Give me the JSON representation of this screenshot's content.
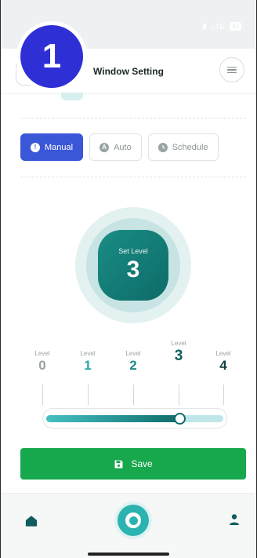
{
  "status_bar": {
    "network": "LTE",
    "battery": "82"
  },
  "step_badge": "1",
  "header": {
    "title": "Window Setting"
  },
  "modes": [
    {
      "label": "Manual",
      "active": true,
      "icon": "alert-circle-icon"
    },
    {
      "label": "Auto",
      "active": false,
      "icon": "auto-icon"
    },
    {
      "label": "Schedule",
      "active": false,
      "icon": "clock-icon"
    }
  ],
  "dial": {
    "label": "Set Level",
    "value": "3"
  },
  "levels": [
    {
      "name": "Level",
      "num": "0",
      "color": "#9aa2a2"
    },
    {
      "name": "Level",
      "num": "1",
      "color": "#27a6a6"
    },
    {
      "name": "Level",
      "num": "2",
      "color": "#1d8a89"
    },
    {
      "name": "Level",
      "num": "3",
      "color": "#0f5d5c"
    },
    {
      "name": "Level",
      "num": "4",
      "color": "#123f3f"
    }
  ],
  "slider": {
    "value": 3,
    "max": 4
  },
  "save_button": {
    "label": "Save"
  },
  "colors": {
    "accent_blue": "#3a57d8",
    "teal": "#0f6b69",
    "save_green": "#17a74c"
  }
}
